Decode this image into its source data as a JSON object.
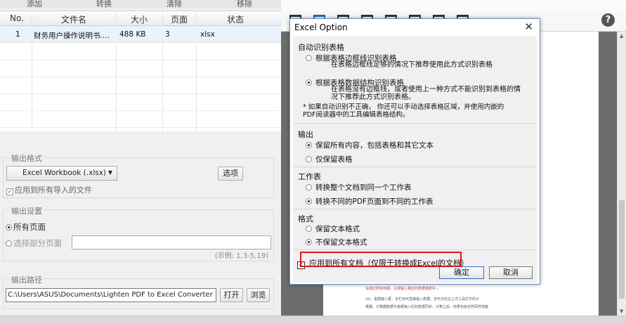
{
  "toolbar_top": {
    "add": "添加",
    "convert": "转换",
    "clear": "清除",
    "remove": "移除"
  },
  "table": {
    "headers": [
      "No.",
      "文件名",
      "大小",
      "页面",
      "状态"
    ],
    "rows": [
      {
        "no": "1",
        "name": "财务用户操作说明书....",
        "size": "488 KB",
        "pages": "3",
        "status": "xlsx"
      }
    ]
  },
  "output_format": {
    "title": "输出格式",
    "selected": "Excel Workbook (.xlsx)",
    "options_button": "选项",
    "apply_all_label": "应用到所有导入的文件"
  },
  "output_settings": {
    "title": "输出设置",
    "all_pages": "所有页面",
    "select_pages": "选择部分页面",
    "example": "(示例: 1,3-5,19)"
  },
  "output_path": {
    "title": "输出路径",
    "path": "C:\\Users\\ASUS\\Documents\\Lighten PDF to Excel Converter",
    "open_button": "打开",
    "browse_button": "浏览"
  },
  "help_icon": "?",
  "dialog": {
    "title": "Excel Option",
    "close": "✕",
    "auto_detect": {
      "title": "自动识别表格",
      "opt1": "根据表格边框线识别表格",
      "opt1_desc": "在表格边框线足够的情况下推荐使用此方式识别表格",
      "opt2": "根据表格数据结构识别表格",
      "opt2_desc1": "在表格没有边框线，或者使用上一种方式不能识别到表格的情",
      "opt2_desc2": "况下推荐此方式识别表格。",
      "note1": "* 如果自动识别不正确， 你还可以手动选择表格区域，并使用内嵌的",
      "note2": "PDF阅读器中的工具编辑表格结构。"
    },
    "output": {
      "title": "输出",
      "opt1": "保留所有内容，包括表格和其它文本",
      "opt2": "仅保留表格"
    },
    "worksheet": {
      "title": "工作表",
      "opt1": "转换整个文档到同一个工作表",
      "opt2": "转换不同的PDF页面到不同的工作表"
    },
    "format": {
      "title": "格式",
      "opt1": "保留文本格式",
      "opt2": "不保留文本格式"
    },
    "apply_all": "应用到所有文档（仅限于转换成Excel的文档）",
    "ok": "确定",
    "cancel": "取消"
  },
  "doc_preview": {
    "line1": "请通过所有到期，以便输入相应的数据或者补 。",
    "line2": "(4)、金额输入框：本栏目可直接输入数据，也可点击左上方工具栏中的计",
    "line3": "算器，计算器数据与金额输入栏的数据同步，计算之后，结果也就自然而然地输"
  },
  "colors": {
    "accent": "#2a66c7",
    "highlight": "#e0141c",
    "row_selected": "#eaf3fc"
  }
}
